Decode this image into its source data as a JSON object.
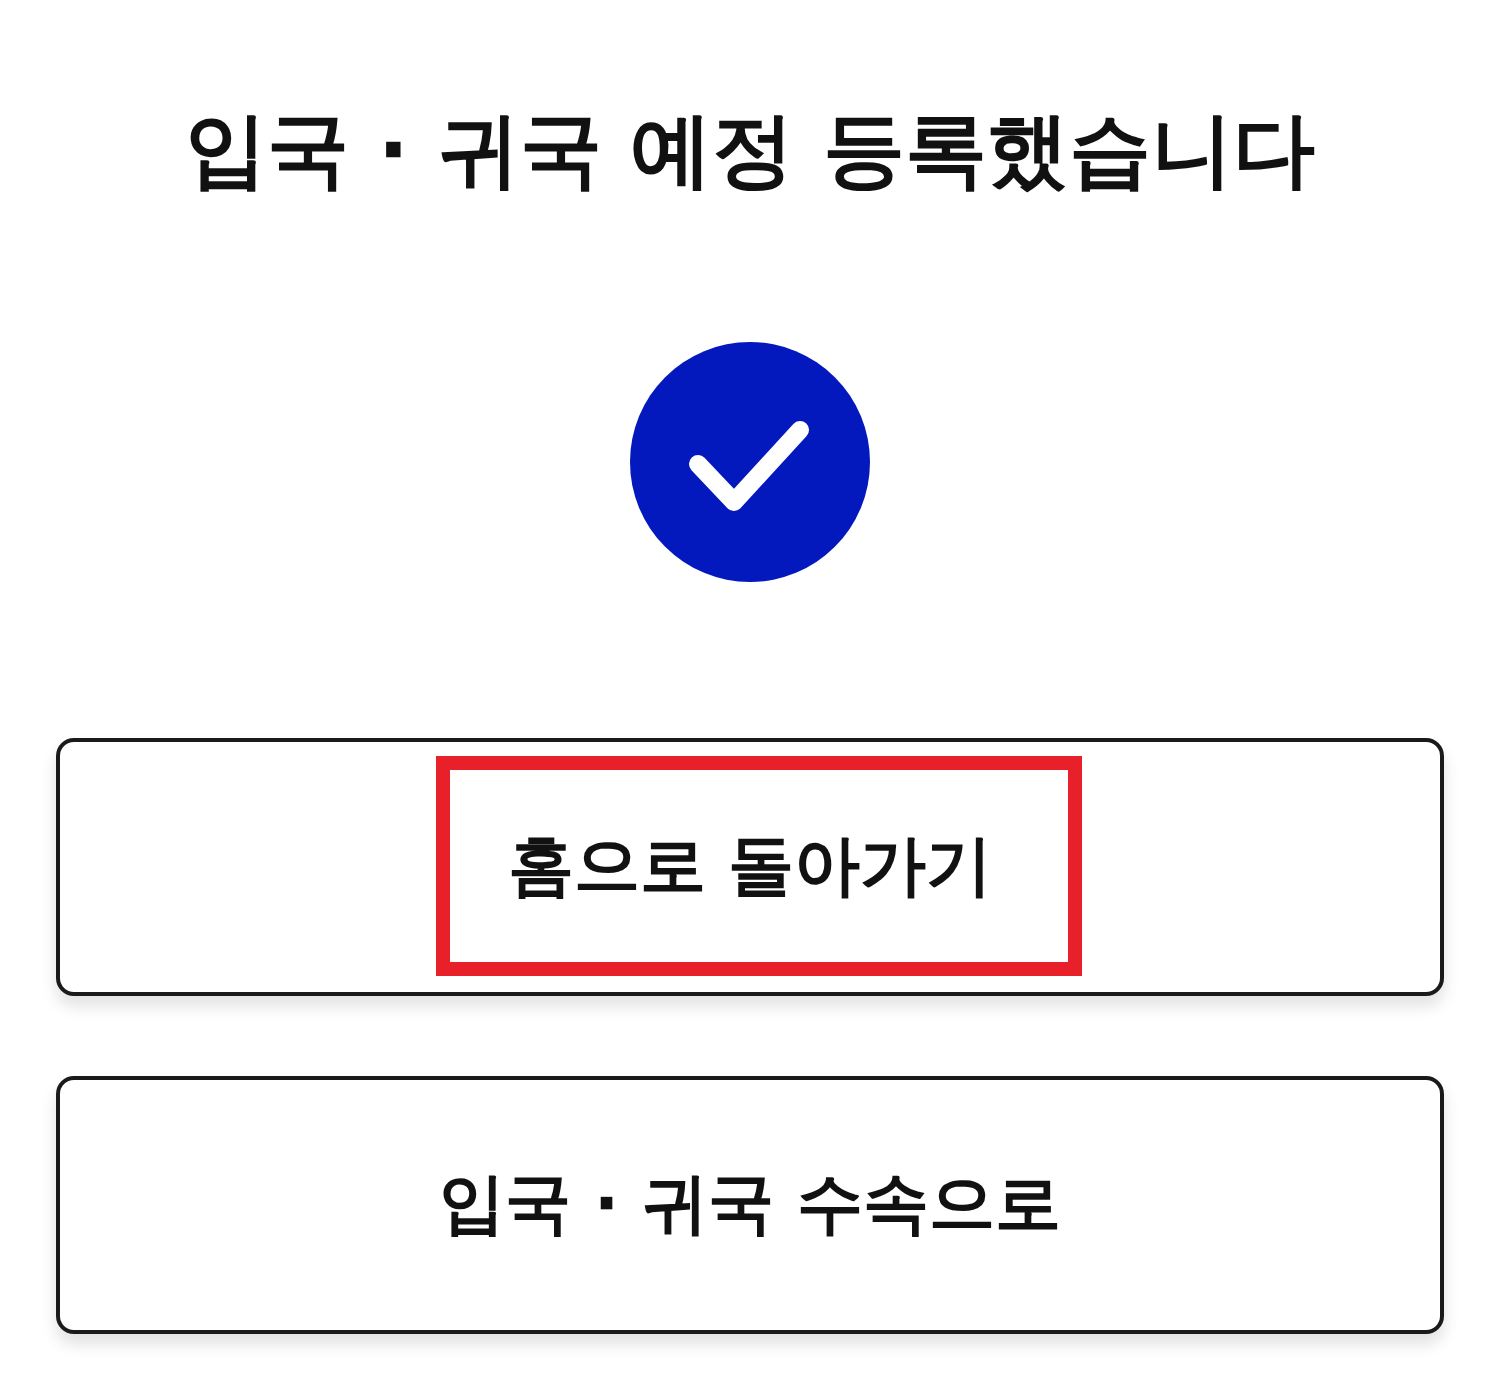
{
  "title": "입국 · 귀국 예정 등록했습니다",
  "buttons": [
    {
      "label": "홈으로 돌아가기",
      "highlighted": true
    },
    {
      "label": "입국 · 귀국 수속으로",
      "highlighted": false
    }
  ]
}
